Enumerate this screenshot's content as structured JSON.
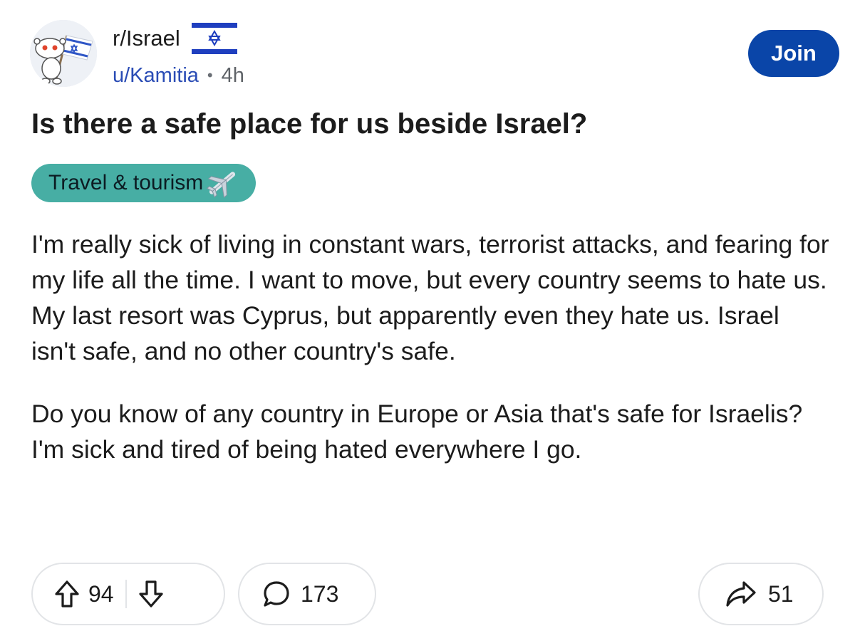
{
  "header": {
    "subreddit": "r/Israel",
    "username": "u/Kamitia",
    "separator": "•",
    "age": "4h",
    "join_label": "Join"
  },
  "post": {
    "title": "Is there a safe place for us beside Israel?",
    "flair": "Travel & tourism",
    "flair_icon": "airplane-emoji",
    "paragraphs": [
      "I'm really sick of living in constant wars, terrorist attacks, and fearing for my life all the time. I want to move, but every country seems to hate us. My last resort was Cyprus, but apparently even they hate us. Israel isn't safe, and no other country's safe.",
      "Do you know of any country in Europe or Asia that's safe for Israelis? I'm sick and tired of being hated everywhere I go."
    ]
  },
  "actions": {
    "upvotes": "94",
    "comments": "173",
    "shares": "51"
  },
  "colors": {
    "accent_blue": "#0a45a8",
    "username_blue": "#2a4cb5",
    "flair_teal": "#47aea4",
    "flag_blue": "#1f3fbf"
  }
}
